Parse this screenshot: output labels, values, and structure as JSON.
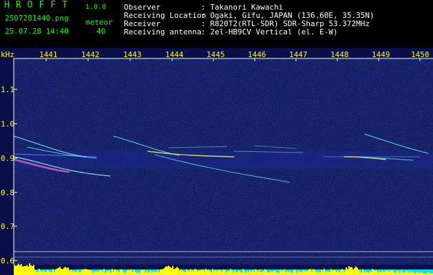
{
  "header": {
    "logo": "HROFFT",
    "version": "1.0.0",
    "filename": "2507281440.png",
    "datetime": "25.07.28 14:40",
    "meteor_label": "meteor",
    "meteor_count": "40",
    "info": [
      {
        "key": "Observer",
        "value": ": Takanori Kawachi"
      },
      {
        "key": "Receiving Location",
        "value": ": Ogaki, Gifu, JAPAN (136.60E, 35.35N)"
      },
      {
        "key": "Receiver",
        "value": ": R820T2(RTL-SDR) SDR-Sharp 53.372MHz"
      },
      {
        "key": "Receiving antenna",
        "value": ": 2el-HB9CV Vertical (el. E-W)"
      }
    ]
  },
  "spectrogram": {
    "unit_label": "kHz",
    "x_ticks": [
      "1441",
      "1442",
      "1443",
      "1444",
      "1445",
      "1446",
      "1447",
      "1448",
      "1449",
      "1450"
    ],
    "y_ticks": [
      "1.1",
      "1.0",
      "0.9",
      "0.8",
      "0.7",
      "0.6"
    ],
    "colors": {
      "background": "#0a0f4a",
      "axis": "#ffffff",
      "tick_label": "#ffff00",
      "level_bars": "#ffff00",
      "level_base": "#00e5ff"
    }
  }
}
